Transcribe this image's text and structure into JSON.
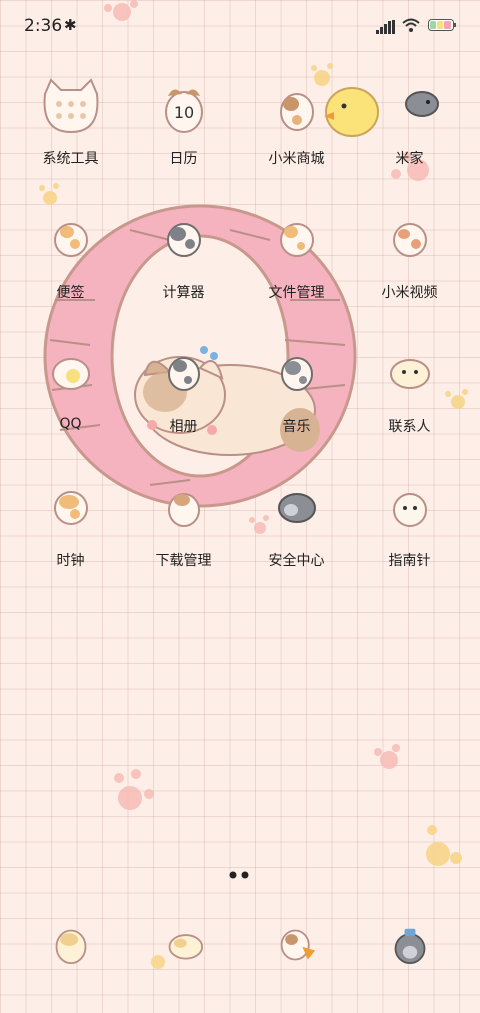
{
  "status_bar": {
    "time": "2:36",
    "bluetooth_icon": "bluetooth-icon",
    "signal_icon": "signal-icon",
    "wifi_icon": "wifi-icon",
    "battery_icon": "battery-icon"
  },
  "wallpaper": {
    "theme": "hamster wheel with cat"
  },
  "home": {
    "apps": [
      {
        "label": "系统工具",
        "icon": "folder-system-tools-icon"
      },
      {
        "label": "日历",
        "icon": "calendar-icon",
        "badge": "10"
      },
      {
        "label": "小米商城",
        "icon": "mi-store-icon"
      },
      {
        "label": "米家",
        "icon": "mi-home-icon"
      },
      {
        "label": "便签",
        "icon": "notes-icon"
      },
      {
        "label": "计算器",
        "icon": "calculator-icon"
      },
      {
        "label": "文件管理",
        "icon": "file-manager-icon"
      },
      {
        "label": "小米视频",
        "icon": "mi-video-icon"
      },
      {
        "label": "QQ",
        "icon": "qq-icon"
      },
      {
        "label": "相册",
        "icon": "gallery-icon"
      },
      {
        "label": "音乐",
        "icon": "music-icon"
      },
      {
        "label": "联系人",
        "icon": "contacts-icon"
      },
      {
        "label": "时钟",
        "icon": "clock-icon"
      },
      {
        "label": "下载管理",
        "icon": "downloads-icon"
      },
      {
        "label": "安全中心",
        "icon": "security-icon"
      },
      {
        "label": "指南针",
        "icon": "compass-icon"
      }
    ]
  },
  "dock": {
    "apps": [
      {
        "icon": "phone-icon"
      },
      {
        "icon": "messages-icon"
      },
      {
        "icon": "browser-icon"
      },
      {
        "icon": "camera-icon"
      }
    ]
  },
  "page_indicator": {
    "pages": 2,
    "current": 1
  }
}
